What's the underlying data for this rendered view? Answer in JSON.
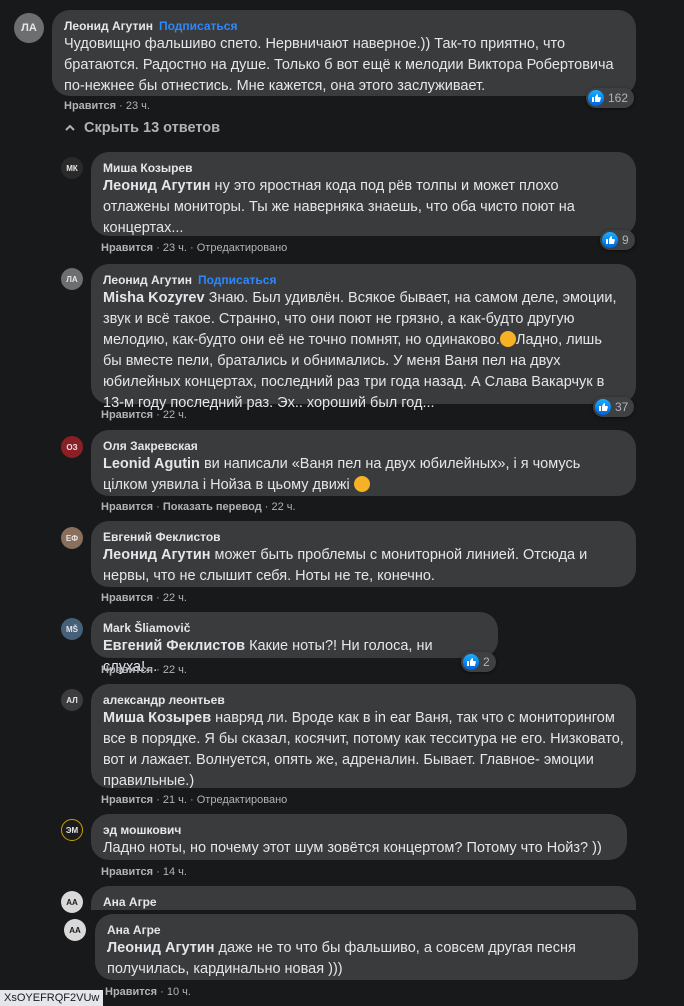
{
  "top_comment": {
    "author": "Леонид Агутин",
    "follow_label": "Подписаться",
    "text": "Чудовищно фальшиво спето. Нервничают наверное.)) Так-то приятно, что братаются. Радостно на душе. Только б вот ещё к мелодии Виктора Робертовича по-нежнее бы отнестись. Мне кажется, она этого заслуживает.",
    "like_label": "Нравится",
    "time": "23 ч.",
    "reactions": "162"
  },
  "hide_replies_label": "Скрыть 13 ответов",
  "replies": [
    {
      "author": "Миша Козырев",
      "mention": "Леонид Агутин",
      "text": " ну это яростная кода под рёв толпы и может плохо отлажены мониторы. Ты же наверняка знаешь, что оба чисто поют на концертах...",
      "like_label": "Нравится",
      "time": "23 ч.",
      "extra": "Отредактировано",
      "reactions": "9"
    },
    {
      "author": "Леонид Агутин",
      "follow_label": "Подписаться",
      "mention": "Misha Kozyrev",
      "text": " Знаю. Был удивлён. Всякое бывает, на самом деле, эмоции, звук и всё такое. Странно, что они поют не грязно, а как-будто другую мелодию, как-будто они её не точно помнят, но одинаково.",
      "text2": "Ладно, лишь бы вместе пели, братались и обнимались. У меня Ваня пел на двух юбилейных концертах, последний раз три года назад. А Слава Вакарчук в 13-м году последний раз. Эх.. хороший был год...",
      "like_label": "Нравится",
      "time": "22 ч.",
      "reactions": "37"
    },
    {
      "author": "Оля Закревская",
      "mention": "Leonid Agutin",
      "text": " ви написали «Ваня пел на двух юбилейных», і я чомусь цілком уявила і Нойза в цьому движі",
      "like_label": "Нравится",
      "extra": "Показать перевод",
      "time": "22 ч."
    },
    {
      "author": "Евгений Феклистов",
      "mention": "Леонид Агутин",
      "text": " может быть проблемы с мониторной линией. Отсюда и нервы, что не слышит себя. Ноты не те, конечно.",
      "like_label": "Нравится",
      "time": "22 ч."
    },
    {
      "author": "Mark Šliamovič",
      "mention": "Евгений Феклистов",
      "text": " Какие ноты?! Ни голоса, ни слуха!...",
      "like_label": "Нравится",
      "time": "22 ч.",
      "reactions": "2"
    },
    {
      "author": "александр леонтьев",
      "mention": "Миша Козырев",
      "text": " навряд ли. Вроде как в in ear Ваня, так что с мониторингом все в порядке. Я бы сказал, косячит, потому как тесситура не его. Низковато, вот и лажает. Волнуется, опять же, адреналин. Бывает. Главное- эмоции правильные.)",
      "like_label": "Нравится",
      "time": "21 ч.",
      "extra": "Отредактировано"
    },
    {
      "author": "эд мошкович",
      "text": "Ладно ноты, но почему этот шум зовётся концертом? Потому что Нойз? ))",
      "like_label": "Нравится",
      "time": "14 ч."
    },
    {
      "author": "Ана Агре"
    },
    {
      "author": "Ана Агре",
      "mention": "Леонид Агутин",
      "text": " даже не то что бы фальшиво, а совсем другая песня получилась, кардинально новая )))",
      "like_label": "Нравится",
      "time": "10 ч."
    }
  ],
  "footer_label": "XsOYEFRQF2VUw",
  "colors": {
    "background": "#18191a",
    "bubble": "#3a3b3c",
    "link": "#2d88ff",
    "meta": "#b0b3b8"
  }
}
